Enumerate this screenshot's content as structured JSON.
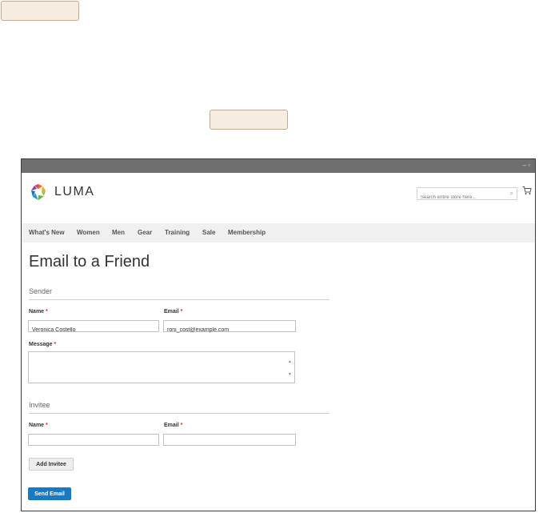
{
  "store": {
    "name": "LUMA"
  },
  "search": {
    "placeholder": "Search entire store here..."
  },
  "nav": {
    "items": [
      "What's New",
      "Women",
      "Men",
      "Gear",
      "Training",
      "Sale",
      "Membership"
    ]
  },
  "page": {
    "title": "Email to a Friend"
  },
  "sender": {
    "legend": "Sender",
    "name_label": "Name",
    "name_value": "Veronica Costello",
    "email_label": "Email",
    "email_value": "roni_cost@example.com",
    "message_label": "Message",
    "message_value": ""
  },
  "invitee": {
    "legend": "Invitee",
    "name_label": "Name",
    "name_value": "",
    "email_label": "Email",
    "email_value": ""
  },
  "required_marker": "*",
  "buttons": {
    "add_invitee": "Add Invitee",
    "send_email": "Send Email"
  },
  "colors": {
    "primary_button": "#1979c3",
    "callout_fill": "#f6ecdf",
    "required": "#e02b27"
  }
}
